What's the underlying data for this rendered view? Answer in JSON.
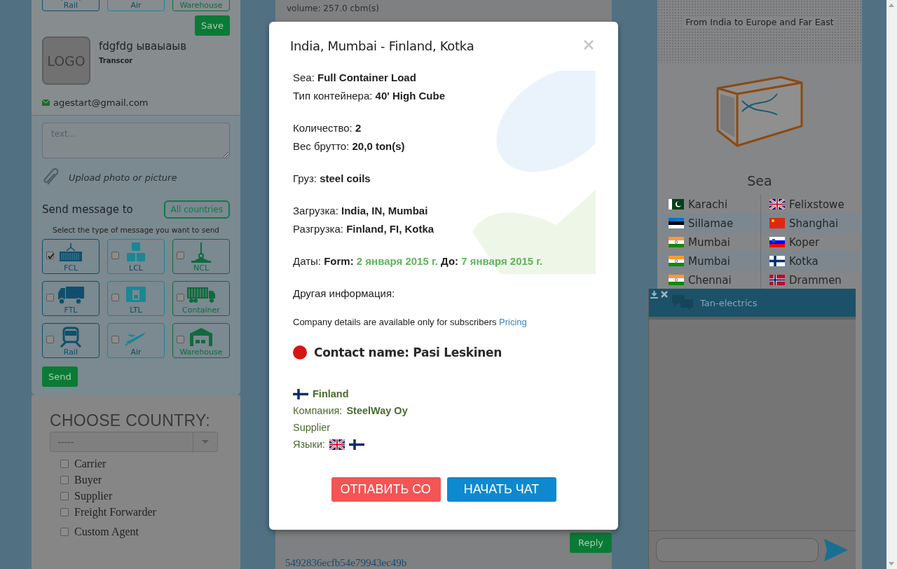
{
  "left_panel": {
    "top_tiles": [
      {
        "label": "Rail",
        "kind": "rail"
      },
      {
        "label": "Air",
        "kind": "air"
      },
      {
        "label": "Warehouse",
        "kind": "warehouse"
      }
    ],
    "save_button": "Save",
    "profile": {
      "logo": "LOGO",
      "name": "fdgfdg ываыаыв",
      "company": "Transcor",
      "email": "agestart@gmail.com"
    },
    "message_form": {
      "placeholder": "text...",
      "upload": "Upload photo or picture",
      "send_to": "Send message to",
      "countries_button": "All countries",
      "hint": "Select the type of message you want to send",
      "types": [
        {
          "label": "FCL",
          "kind": "fcl",
          "checked": true
        },
        {
          "label": "LCL",
          "kind": "lcl",
          "checked": false
        },
        {
          "label": "NCL",
          "kind": "ncl",
          "checked": false
        },
        {
          "label": "FTL",
          "kind": "ftl",
          "checked": false
        },
        {
          "label": "LTL",
          "kind": "ltl",
          "checked": false
        },
        {
          "label": "Container",
          "kind": "container",
          "checked": false
        },
        {
          "label": "Rail",
          "kind": "rail",
          "checked": false
        },
        {
          "label": "Air",
          "kind": "air",
          "checked": false
        },
        {
          "label": "Warehouse",
          "kind": "warehouse",
          "checked": false
        }
      ],
      "send_button": "Send"
    },
    "country_filter": {
      "heading": "CHOOSE COUNTRY:",
      "select_value": "-----",
      "roles": [
        {
          "label": "Carrier",
          "checked": false
        },
        {
          "label": "Buyer",
          "checked": false
        },
        {
          "label": "Supplier",
          "checked": false
        },
        {
          "label": "Freight Forwarder",
          "checked": false
        },
        {
          "label": "Custom Agent",
          "checked": false
        }
      ]
    }
  },
  "center": {
    "volume": "volume: 257.0 cbm(s)",
    "reply_button": "Reply",
    "link": "5492836ecfb54e79943ec49b"
  },
  "right": {
    "banner": "From India to Europe and Far East",
    "sea": {
      "title": "Sea",
      "rows": [
        {
          "left": {
            "city": "Karachi",
            "kind": "pk"
          },
          "right": {
            "city": "Felixstowe",
            "kind": "gb"
          }
        },
        {
          "left": {
            "city": "Sillamae",
            "kind": "ee"
          },
          "right": {
            "city": "Shanghai",
            "kind": "cn"
          }
        },
        {
          "left": {
            "city": "Mumbai",
            "kind": "in"
          },
          "right": {
            "city": "Koper",
            "kind": "si"
          }
        },
        {
          "left": {
            "city": "Mumbai",
            "kind": "in"
          },
          "right": {
            "city": "Kotka",
            "kind": "fi"
          }
        },
        {
          "left": {
            "city": "Chennai",
            "kind": "in"
          },
          "right": {
            "city": "Drammen",
            "kind": "no"
          }
        }
      ]
    }
  },
  "chat": {
    "title": "Tan-electrics"
  },
  "modal": {
    "title": "India, Mumbai - Finland, Kotka",
    "groups": [
      [
        {
          "label": "Sea: ",
          "value": "Full Container Load"
        },
        {
          "label": "Тип контейнера:",
          "value": "40' High Cube"
        }
      ],
      [
        {
          "label": "Количество:",
          "value": "2"
        },
        {
          "label": "Вес брутто:",
          "value": "20,0 ton(s)"
        }
      ],
      [
        {
          "label": "Груз:",
          "value": "steel coils"
        }
      ],
      [
        {
          "label": "Загрузка:",
          "value": "India, IN, Mumbai"
        },
        {
          "label": "Разгрузка:",
          "value": "Finland, FI, Kotka"
        }
      ]
    ],
    "dates": {
      "label": "Даты:",
      "from_label": "Form:",
      "from": "2 января 2015 г.",
      "to_label": "До:",
      "to": "7 января 2015 г."
    },
    "other": "Другая информация:",
    "notice": {
      "text": "Company details are available only for subscribers",
      "link": "Pricing"
    },
    "contact": {
      "name": "Contact name: Pasi Leskinen",
      "online": false
    },
    "company": {
      "country": {
        "label": "Finland",
        "kind": "fi"
      },
      "company_label": "Компания:",
      "company": "SteelWay Oy",
      "role": "Supplier",
      "languages_label": "Языки:",
      "languages": [
        {
          "kind": "gb"
        },
        {
          "kind": "fi"
        }
      ]
    },
    "buttons": [
      {
        "label": "ОТПАВИТЬ СО",
        "kind": "message"
      },
      {
        "label": "НАЧАТЬ ЧАТ",
        "kind": "chat"
      }
    ]
  }
}
